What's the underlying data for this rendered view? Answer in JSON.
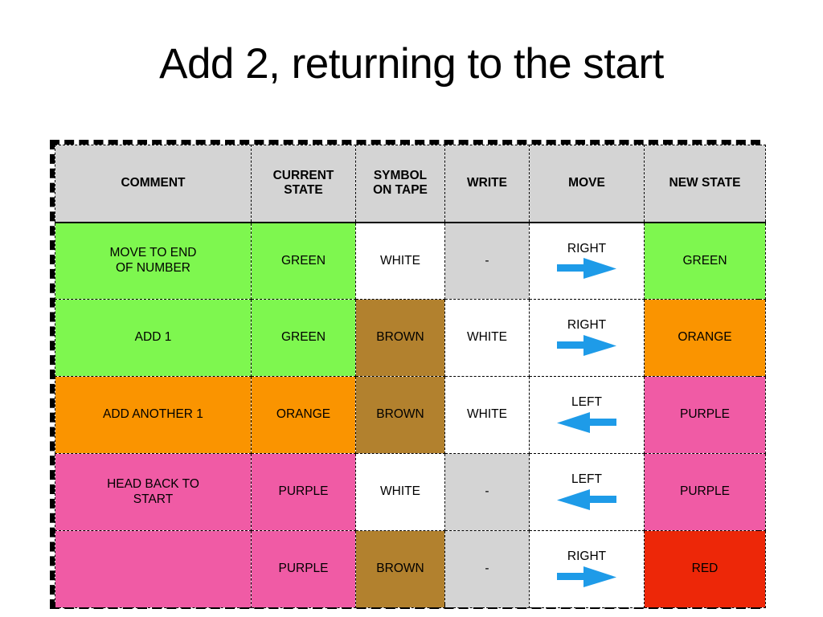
{
  "slide": {
    "title": "Add 2, returning to the start",
    "background_color": "#FFFFFF"
  },
  "palette": {
    "green": "#7EF74F",
    "orange": "#FA9400",
    "pink": "#F05BA5",
    "brown": "#B2812E",
    "white": "#FFFFFF",
    "grey": "#D4D4D4",
    "red": "#ED2708",
    "arrow_blue": "#1E9BE8",
    "border_black": "#000000"
  },
  "table": {
    "columns": [
      {
        "key": "comment",
        "label": "COMMENT"
      },
      {
        "key": "current_state",
        "label": "CURRENT STATE"
      },
      {
        "key": "symbol_on_tape",
        "label": "SYMBOL ON TAPE"
      },
      {
        "key": "write",
        "label": "WRITE"
      },
      {
        "key": "move",
        "label": "MOVE"
      },
      {
        "key": "new_state",
        "label": "NEW STATE"
      }
    ],
    "header_labels_wrapped": {
      "current_state_line1": "CURRENT",
      "current_state_line2": "STATE",
      "symbol_on_tape_line1": "SYMBOL",
      "symbol_on_tape_line2": "ON TAPE"
    },
    "rows": [
      {
        "comment": "MOVE TO END OF NUMBER",
        "comment_line1": "MOVE TO END",
        "comment_line2": "OF NUMBER",
        "comment_color": "green",
        "current_state": "GREEN",
        "current_state_color": "green",
        "symbol_on_tape": "WHITE",
        "symbol_on_tape_color": "white",
        "write": "-",
        "write_color": "grey",
        "move": "RIGHT",
        "move_direction": "right",
        "move_color": "white",
        "new_state": "GREEN",
        "new_state_color": "green"
      },
      {
        "comment": "ADD 1",
        "comment_line1": "ADD 1",
        "comment_line2": "",
        "comment_color": "green",
        "current_state": "GREEN",
        "current_state_color": "green",
        "symbol_on_tape": "BROWN",
        "symbol_on_tape_color": "brown",
        "write": "WHITE",
        "write_color": "white",
        "move": "RIGHT",
        "move_direction": "right",
        "move_color": "white",
        "new_state": "ORANGE",
        "new_state_color": "orange"
      },
      {
        "comment": "ADD ANOTHER 1",
        "comment_line1": "ADD ANOTHER 1",
        "comment_line2": "",
        "comment_color": "orange",
        "current_state": "ORANGE",
        "current_state_color": "orange",
        "symbol_on_tape": "BROWN",
        "symbol_on_tape_color": "brown",
        "write": "WHITE",
        "write_color": "white",
        "move": "LEFT",
        "move_direction": "left",
        "move_color": "white",
        "new_state": "PURPLE",
        "new_state_color": "pink"
      },
      {
        "comment": "HEAD BACK TO START",
        "comment_line1": "HEAD BACK TO",
        "comment_line2": "START",
        "comment_color": "pink",
        "current_state": "PURPLE",
        "current_state_color": "pink",
        "symbol_on_tape": "WHITE",
        "symbol_on_tape_color": "white",
        "write": "-",
        "write_color": "grey",
        "move": "LEFT",
        "move_direction": "left",
        "move_color": "white",
        "new_state": "PURPLE",
        "new_state_color": "pink"
      },
      {
        "comment": "",
        "comment_line1": "",
        "comment_line2": "",
        "comment_color": "pink",
        "current_state": "PURPLE",
        "current_state_color": "pink",
        "symbol_on_tape": "BROWN",
        "symbol_on_tape_color": "brown",
        "write": "-",
        "write_color": "grey",
        "move": "RIGHT",
        "move_direction": "right",
        "move_color": "white",
        "new_state": "RED",
        "new_state_color": "red"
      }
    ]
  }
}
